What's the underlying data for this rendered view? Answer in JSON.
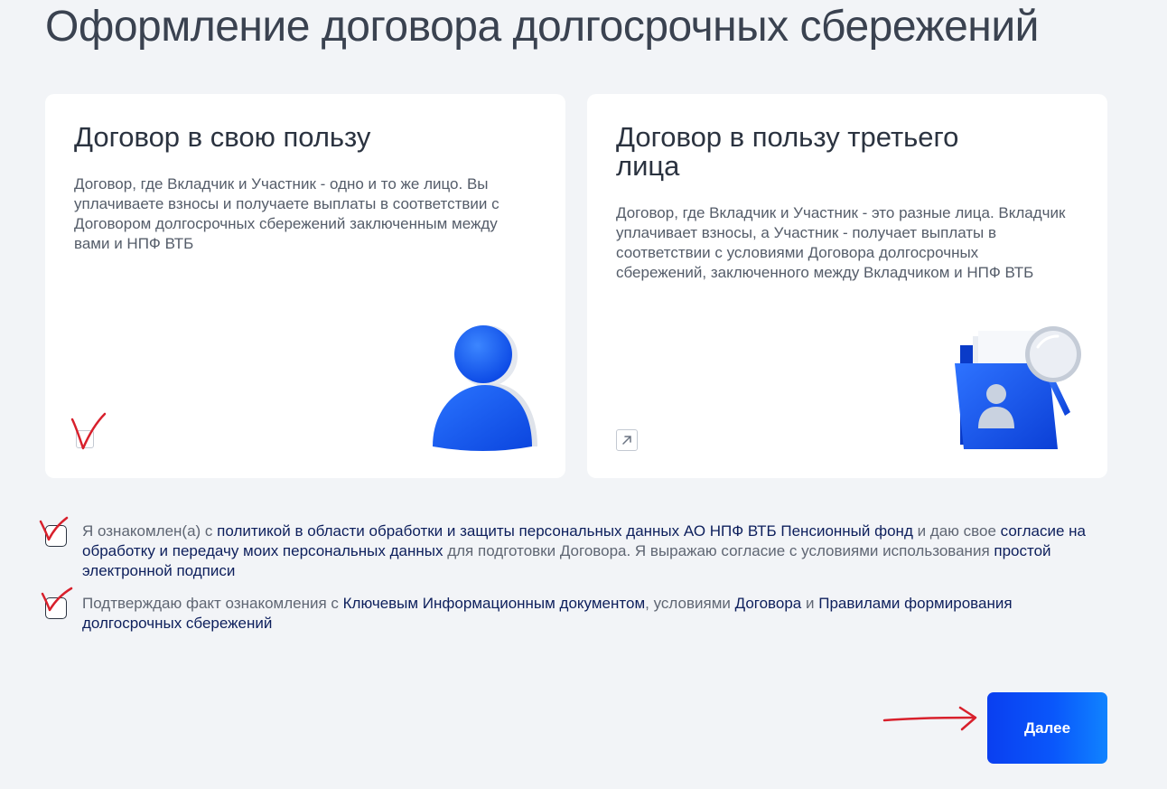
{
  "page": {
    "title": "Оформление договора долгосрочных сбережений"
  },
  "cards": [
    {
      "title": "Договор в свою пользу",
      "description": "Договор, где Вкладчик и Участник - одно и то же лицо. Вы уплачиваете взносы и получаете выплаты в соответствии с Договором долгосрочных сбережений заключенным между вами и НПФ ВТБ",
      "icon": "person-icon",
      "control_icon": "checkbox"
    },
    {
      "title": "Договор в пользу третьего лица",
      "description": "Договор, где Вкладчик и Участник - это разные лица. Вкладчик уплачивает взносы, а Участник - получает выплаты в соответствии с условиями Договора долгосрочных сбережений, заключенного между Вкладчиком и НПФ ВТБ",
      "icon": "folder-search-icon",
      "control_icon": "external-link-icon"
    }
  ],
  "consents": [
    {
      "text_1": "Я ознакомлен(а) с ",
      "link_1": "политикой в области обработки и защиты персональных данных АО НПФ ВТБ Пенсионный фонд",
      "text_2": " и даю свое ",
      "link_2": "согласие на обработку и передачу моих персональных данных",
      "text_3": " для подготовки Договора. Я выражаю согласие с условиями использования ",
      "link_3": "простой электронной подписи"
    },
    {
      "text_1": "Подтверждаю факт ознакомления с ",
      "link_1": "Ключевым Информационным документом",
      "text_2": ", условиями ",
      "link_2": "Договора",
      "text_3": " и ",
      "link_3": "Правилами формирования долгосрочных сбережений"
    }
  ],
  "actions": {
    "next_label": "Далее"
  },
  "colors": {
    "background": "#f2f4f7",
    "card": "#ffffff",
    "accent": "#0a4ef5",
    "link": "#0d1f5c",
    "annotation": "#d8202c"
  }
}
